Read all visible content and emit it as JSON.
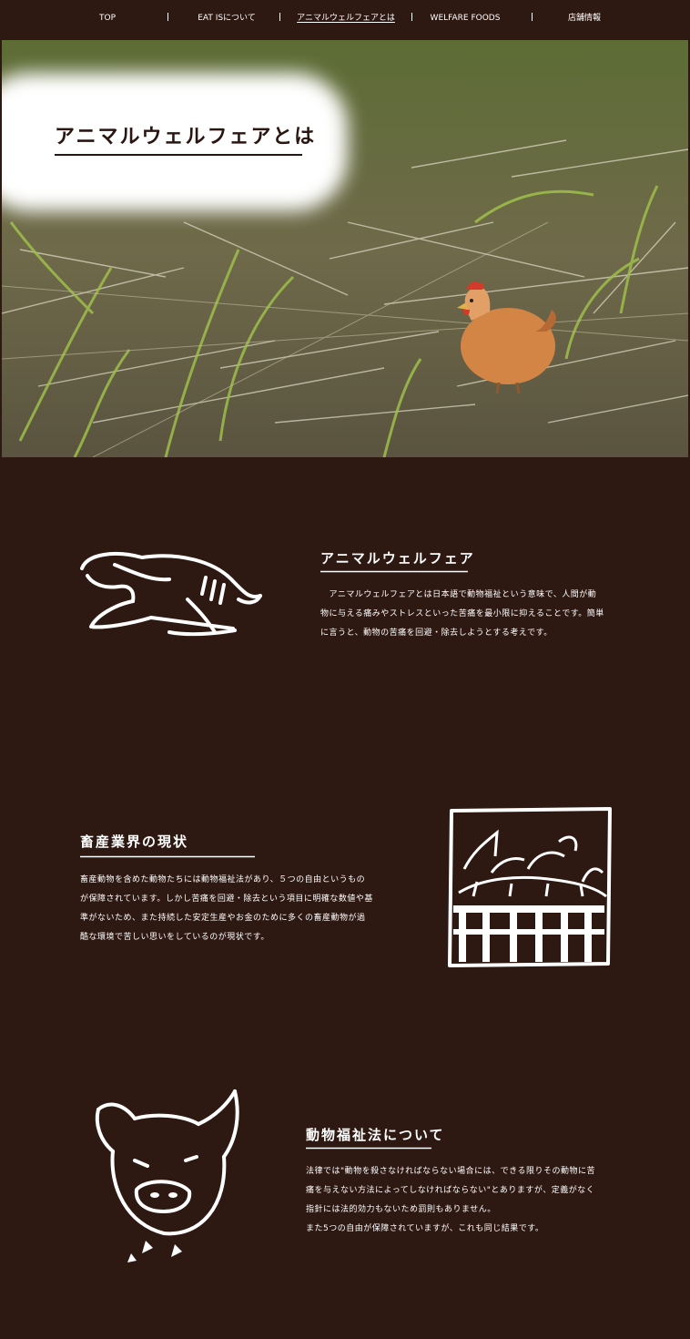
{
  "nav": {
    "items": [
      {
        "label": "TOP"
      },
      {
        "label": "EAT ISについて"
      },
      {
        "label": "アニマルウェルフェアとは"
      },
      {
        "label": "WELFARE FOODS"
      },
      {
        "label": "店舗情報"
      }
    ],
    "active_index": 2
  },
  "hero": {
    "title": "アニマルウェルフェアとは"
  },
  "sections": [
    {
      "title": "アニマルウェルフェア",
      "body": "　アニマルウェルフェアとは日本語で動物福祉という意味で、人間が動物に与える痛みやストレスといった苦痛を最小限に抑えることです。簡単に言うと、動物の苦痛を回避・除去しようとする考えです。",
      "illustration": "sleeping-dog-icon"
    },
    {
      "title": "畜産業界の現状",
      "body": "畜産動物を含めた動物たちには動物福祉法があり、５つの自由というものが保障されています。しかし苦痛を回避・除去という項目に明確な数値や基準がないため、また持続した安定生産やお金のために多くの畜産動物が過酷な環境で苦しい思いをしているのが現状です。",
      "illustration": "caged-chickens-icon"
    },
    {
      "title": "動物福祉法について",
      "body": "法律では\"動物を殺さなければならない場合には、できる限りその動物に苦痛を与えない方法によってしなければならない\"とありますが、定義がなく指針には法的効力もないため罰則もありません。\nまた5つの自由が保障されていますが、これも同じ結果です。",
      "illustration": "pig-face-icon"
    }
  ],
  "colors": {
    "background": "#2e1812",
    "text": "#ffffff",
    "title_dark": "#2a1510"
  }
}
